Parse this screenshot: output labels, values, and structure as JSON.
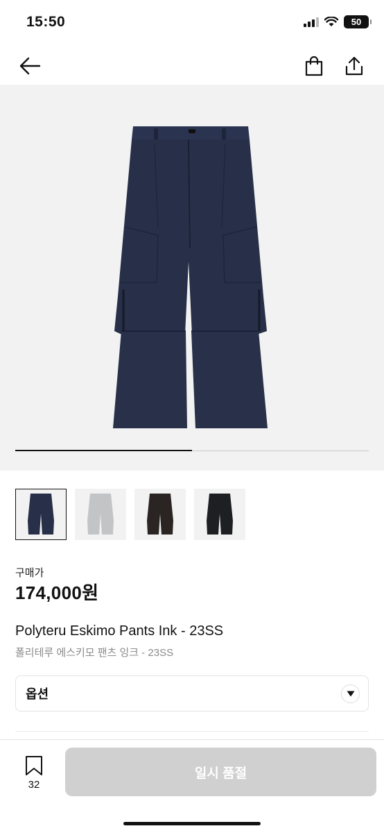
{
  "status_bar": {
    "time": "15:50",
    "battery": "50"
  },
  "nav": {
    "back": "arrow-left",
    "cart": "shopping-bag",
    "share": "share-upload"
  },
  "gallery": {
    "progress": 0.5,
    "thumbnails": [
      {
        "color": "#273048",
        "label": "ink"
      },
      {
        "color": "#c2c4c6",
        "label": "grey"
      },
      {
        "color": "#2a2522",
        "label": "brown"
      },
      {
        "color": "#1e1f22",
        "label": "black"
      }
    ],
    "active_index": 0
  },
  "price": {
    "label": "구매가",
    "value": "174,000원"
  },
  "product": {
    "title_en": "Polyteru Eskimo Pants Ink - 23SS",
    "title_ko": "폴리테루 에스키모 팬츠 잉크 - 23SS"
  },
  "option": {
    "label": "옵션"
  },
  "bottom": {
    "bookmark_count": "32",
    "cta_label": "일시 품절"
  },
  "colors": {
    "accent": "#111111",
    "disabled": "#d0d0d0",
    "hero_bg": "#f2f2f2",
    "pants_main": "#273048"
  }
}
